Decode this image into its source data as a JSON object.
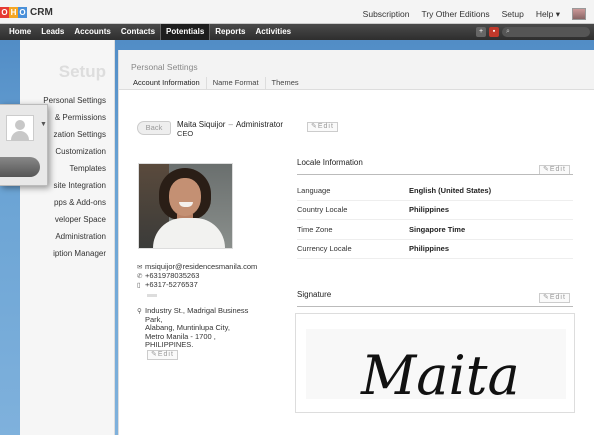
{
  "app": {
    "logo_letters": [
      "O",
      "H",
      "O"
    ],
    "logo_colors": [
      "#e53a33",
      "#f5a623",
      "#4a90d9"
    ],
    "name": "CRM"
  },
  "top_links": [
    "Subscription",
    "Try Other Editions",
    "Setup",
    "Help"
  ],
  "nav": {
    "items": [
      "Home",
      "Leads",
      "Accounts",
      "Contacts",
      "Potentials",
      "Reports",
      "Activities"
    ],
    "active": "Potentials"
  },
  "setup": {
    "title": "Setup",
    "items": [
      "Personal Settings",
      "& Permissions",
      "zation Settings",
      "Customization",
      "Templates",
      "site Integration",
      "pps & Add-ons",
      "veloper Space",
      "Administration",
      "iption Manager"
    ]
  },
  "personal": {
    "title": "Personal Settings",
    "tabs": [
      "Account Information",
      "Name Format",
      "Themes"
    ],
    "back_label": "Back",
    "user_name": "Maita Siquijor",
    "separator": "–",
    "user_type": "Administrator",
    "role": "CEO",
    "edit_label": "Edit"
  },
  "contact": {
    "email": "msiquijor@residencesmanila.com",
    "phone": "+631978035263",
    "fax": "+6317-5276537",
    "address": [
      "Industry St., Madrigal Business",
      "Park,",
      "Alabang, Muntinlupa City,",
      "Metro Manila - 1700 ,",
      "PHILIPPINES."
    ]
  },
  "locale": {
    "title": "Locale Information",
    "rows": [
      {
        "label": "Language",
        "value": "English (United States)"
      },
      {
        "label": "Country Locale",
        "value": "Philippines"
      },
      {
        "label": "Time Zone",
        "value": "Singapore Time"
      },
      {
        "label": "Currency Locale",
        "value": "Philippines"
      }
    ]
  },
  "signature": {
    "title": "Signature",
    "text": "Maita"
  }
}
